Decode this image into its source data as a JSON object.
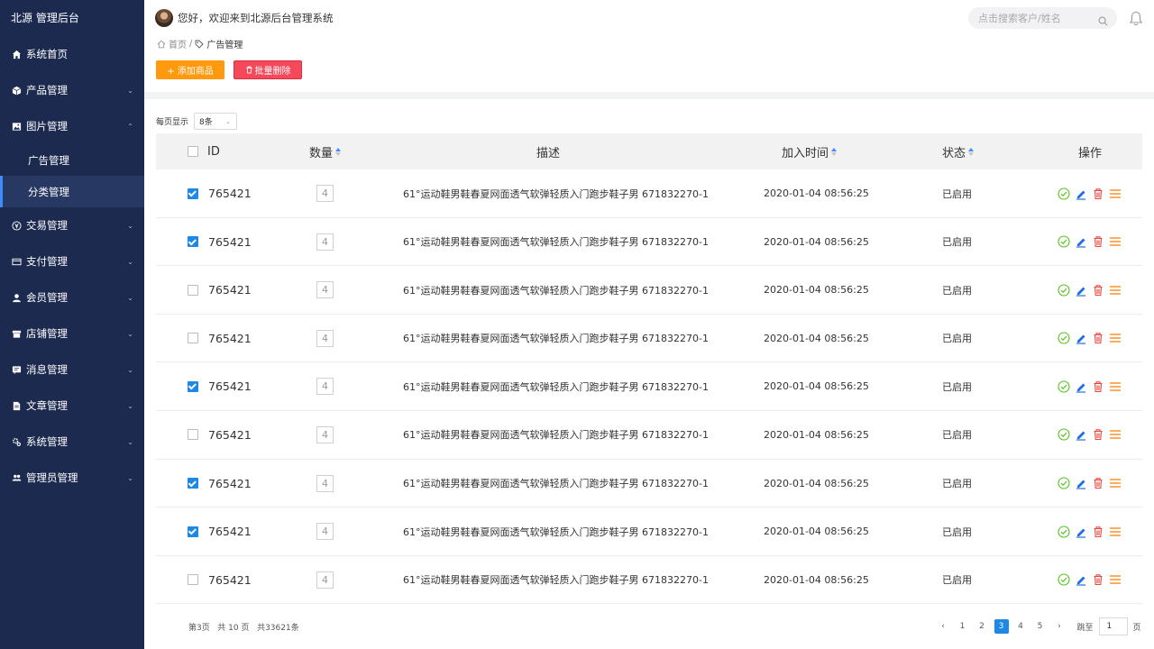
{
  "brand": "北源 管理后台",
  "sidebar": {
    "items": [
      {
        "label": "系统首页",
        "icon": "home-icon",
        "chevron": false
      },
      {
        "label": "产品管理",
        "icon": "box-icon",
        "chevron": true
      },
      {
        "label": "图片管理",
        "icon": "image-icon",
        "chevron": true,
        "expanded": true
      },
      {
        "label": "交易管理",
        "icon": "yen-icon",
        "chevron": true
      },
      {
        "label": "支付管理",
        "icon": "card-icon",
        "chevron": true
      },
      {
        "label": "会员管理",
        "icon": "user-icon",
        "chevron": true
      },
      {
        "label": "店铺管理",
        "icon": "store-icon",
        "chevron": true
      },
      {
        "label": "消息管理",
        "icon": "message-icon",
        "chevron": true
      },
      {
        "label": "文章管理",
        "icon": "document-icon",
        "chevron": true
      },
      {
        "label": "系统管理",
        "icon": "gear-icon",
        "chevron": true
      },
      {
        "label": "管理员管理",
        "icon": "users-icon",
        "chevron": true
      }
    ],
    "subitems": [
      {
        "label": "广告管理",
        "active": false
      },
      {
        "label": "分类管理",
        "active": true
      }
    ]
  },
  "header": {
    "welcome": "您好，欢迎来到北源后台管理系统",
    "search_placeholder": "点击搜索客户/姓名"
  },
  "breadcrumb": {
    "home": "首页",
    "separator": "/",
    "current": "广告管理"
  },
  "toolbar": {
    "add_label": "+ 添加商品",
    "delete_label": "批量删除"
  },
  "perpage": {
    "label": "每页显示",
    "value": "8条"
  },
  "table": {
    "headers": {
      "id": "ID",
      "qty": "数量",
      "desc": "描述",
      "time": "加入时间",
      "status": "状态",
      "ops": "操作"
    },
    "rows": [
      {
        "checked": true,
        "id": "765421",
        "qty": "4",
        "desc": "61°运动鞋男鞋春夏网面透气软弹轻质入门跑步鞋子男 671832270-1",
        "time": "2020-01-04 08:56:25",
        "status": "已启用"
      },
      {
        "checked": true,
        "id": "765421",
        "qty": "4",
        "desc": "61°运动鞋男鞋春夏网面透气软弹轻质入门跑步鞋子男 671832270-1",
        "time": "2020-01-04 08:56:25",
        "status": "已启用"
      },
      {
        "checked": false,
        "id": "765421",
        "qty": "4",
        "desc": "61°运动鞋男鞋春夏网面透气软弹轻质入门跑步鞋子男 671832270-1",
        "time": "2020-01-04 08:56:25",
        "status": "已启用"
      },
      {
        "checked": false,
        "id": "765421",
        "qty": "4",
        "desc": "61°运动鞋男鞋春夏网面透气软弹轻质入门跑步鞋子男 671832270-1",
        "time": "2020-01-04 08:56:25",
        "status": "已启用"
      },
      {
        "checked": true,
        "id": "765421",
        "qty": "4",
        "desc": "61°运动鞋男鞋春夏网面透气软弹轻质入门跑步鞋子男 671832270-1",
        "time": "2020-01-04 08:56:25",
        "status": "已启用"
      },
      {
        "checked": false,
        "id": "765421",
        "qty": "4",
        "desc": "61°运动鞋男鞋春夏网面透气软弹轻质入门跑步鞋子男 671832270-1",
        "time": "2020-01-04 08:56:25",
        "status": "已启用"
      },
      {
        "checked": true,
        "id": "765421",
        "qty": "4",
        "desc": "61°运动鞋男鞋春夏网面透气软弹轻质入门跑步鞋子男 671832270-1",
        "time": "2020-01-04 08:56:25",
        "status": "已启用"
      },
      {
        "checked": true,
        "id": "765421",
        "qty": "4",
        "desc": "61°运动鞋男鞋春夏网面透气软弹轻质入门跑步鞋子男 671832270-1",
        "time": "2020-01-04 08:56:25",
        "status": "已启用"
      },
      {
        "checked": false,
        "id": "765421",
        "qty": "4",
        "desc": "61°运动鞋男鞋春夏网面透气软弹轻质入门跑步鞋子男 671832270-1",
        "time": "2020-01-04 08:56:25",
        "status": "已启用"
      }
    ]
  },
  "pagination": {
    "info": "第3页   共 10 页   共33621条",
    "prev": "‹",
    "next": "›",
    "pages": [
      "1",
      "2",
      "3",
      "4",
      "5"
    ],
    "current": "3",
    "jump_label": "跳至",
    "jump_value": "1",
    "page_unit": "页"
  },
  "colors": {
    "sidebar_bg": "#1c2a4f",
    "accent": "#1e88e5",
    "add_button": "#ff9a0e",
    "delete_button": "#f5495b",
    "enable_icon": "#52c41a",
    "edit_icon": "#1e6fe5",
    "delete_icon": "#e8453c",
    "menu_icon": "#ff8c1a"
  }
}
